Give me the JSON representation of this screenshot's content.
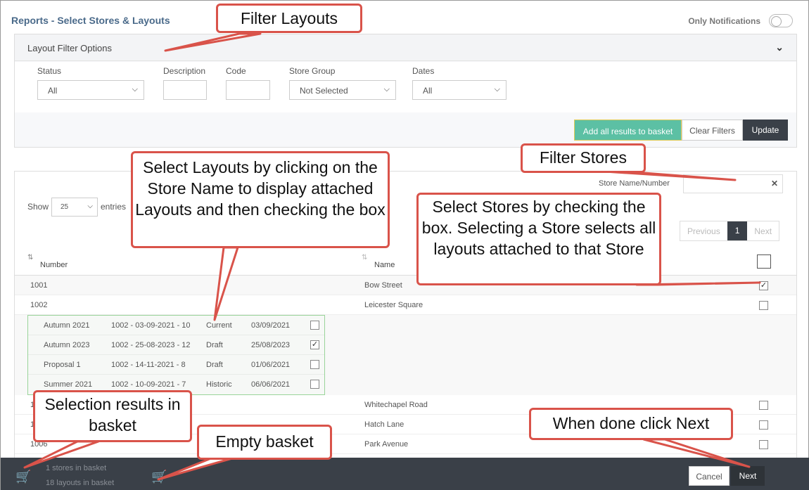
{
  "page": {
    "title": "Reports - Select Stores & Layouts",
    "only_notifications_label": "Only Notifications"
  },
  "filter_panel": {
    "title": "Layout Filter Options",
    "filters": {
      "status": {
        "label": "Status",
        "value": "All"
      },
      "description": {
        "label": "Description",
        "value": ""
      },
      "code": {
        "label": "Code",
        "value": ""
      },
      "store_group": {
        "label": "Store Group",
        "value": "Not Selected"
      },
      "dates": {
        "label": "Dates",
        "value": "All"
      }
    },
    "add_all_label": "Add all results to basket",
    "clear_filters_label": "Clear Filters",
    "update_label": "Update"
  },
  "stores_panel": {
    "show_label": "Show",
    "page_length": "25",
    "entries_label": "entries",
    "store_search_label": "Store Name/Number",
    "pagination": {
      "previous": "Previous",
      "current": "1",
      "next": "Next"
    },
    "columns": {
      "number": "Number",
      "name": "Name"
    },
    "rows": [
      {
        "number": "1001",
        "name": "Bow Street",
        "checked": true
      },
      {
        "number": "1002",
        "name": "Leicester Square",
        "checked": false
      },
      {
        "number": "1",
        "name": "Whitechapel Road",
        "checked": false
      },
      {
        "number": "1",
        "name": "Hatch Lane",
        "checked": false
      },
      {
        "number": "1006",
        "name": "Park Avenue",
        "checked": false
      }
    ],
    "layouts": [
      {
        "name": "Autumn 2021",
        "code": "1002 - 03-09-2021 - 10",
        "status": "Current",
        "date": "03/09/2021",
        "checked": false
      },
      {
        "name": "Autumn 2023",
        "code": "1002 - 25-08-2023 - 12",
        "status": "Draft",
        "date": "25/08/2023",
        "checked": true
      },
      {
        "name": "Proposal 1",
        "code": "1002 - 14-11-2021 - 8",
        "status": "Draft",
        "date": "01/06/2021",
        "checked": false
      },
      {
        "name": "Summer 2021",
        "code": "1002 - 10-09-2021 - 7",
        "status": "Historic",
        "date": "06/06/2021",
        "checked": false
      }
    ]
  },
  "basket": {
    "stores_text": "1 stores in basket",
    "layouts_text": "18 layouts in basket",
    "cancel_label": "Cancel",
    "next_label": "Next"
  },
  "callouts": {
    "filter_layouts": "Filter Layouts",
    "select_layouts": "Select Layouts by clicking on the Store Name to display attached Layouts and then checking the box",
    "filter_stores": "Filter Stores",
    "select_stores": "Select Stores by checking the box. Selecting a Store selects all layouts attached to that Store",
    "selection_results": "Selection results in basket",
    "empty_basket": "Empty basket",
    "when_done": "When done click Next"
  },
  "colors": {
    "accent_green": "#5cc0a4",
    "dark": "#3a4048",
    "callout_border": "#d9534a",
    "basket_icon": "#e05050"
  }
}
